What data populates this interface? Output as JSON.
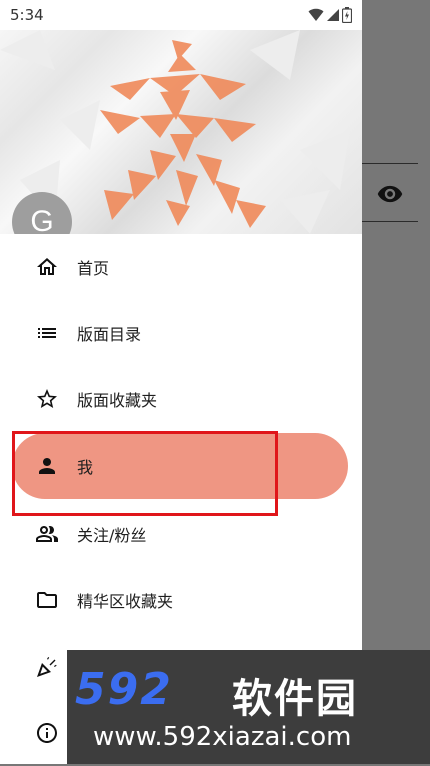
{
  "status_bar": {
    "time": "5:34"
  },
  "avatar": {
    "letter": "G"
  },
  "menu": {
    "items": [
      {
        "label": "首页",
        "icon": "home-icon"
      },
      {
        "label": "版面目录",
        "icon": "list-icon"
      },
      {
        "label": "版面收藏夹",
        "icon": "star-icon"
      },
      {
        "label": "我",
        "icon": "person-icon",
        "active": true
      },
      {
        "label": "关注/粉丝",
        "icon": "people-icon"
      },
      {
        "label": "精华区收藏夹",
        "icon": "folder-icon"
      },
      {
        "label": "",
        "icon": "celebration-icon"
      },
      {
        "label": "",
        "icon": "info-icon"
      }
    ]
  },
  "background": {
    "icon": "eye-icon"
  },
  "watermark": {
    "logo": "592",
    "title": "软件园",
    "url": "www.592xiazai.com"
  },
  "colors": {
    "active_item": "#ef9683",
    "highlight_border": "#e0161a",
    "scrim": "#777777",
    "header_art": "#f08a5a",
    "watermark_logo": "#3b6df0"
  }
}
